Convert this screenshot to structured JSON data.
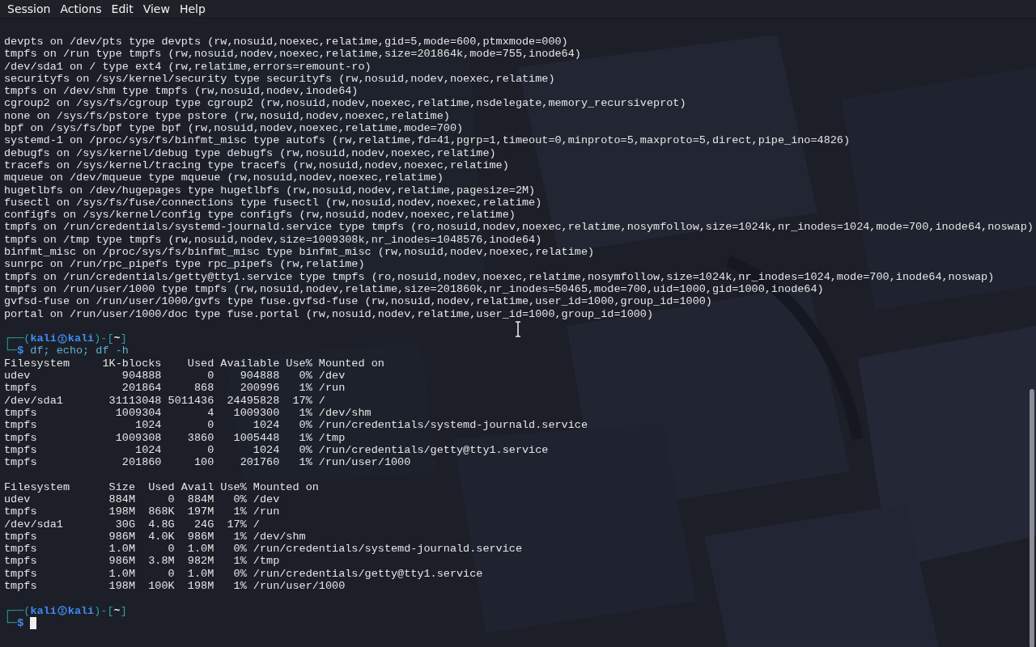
{
  "menu": [
    {
      "label": "Session"
    },
    {
      "label": "Actions"
    },
    {
      "label": "Edit"
    },
    {
      "label": "View"
    },
    {
      "label": "Help"
    }
  ],
  "blocks": [
    {
      "kind": "output",
      "lines": [
        "devpts on /dev/pts type devpts (rw,nosuid,noexec,relatime,gid=5,mode=600,ptmxmode=000)",
        "tmpfs on /run type tmpfs (rw,nosuid,nodev,noexec,relatime,size=201864k,mode=755,inode64)",
        "/dev/sda1 on / type ext4 (rw,relatime,errors=remount-ro)",
        "securityfs on /sys/kernel/security type securityfs (rw,nosuid,nodev,noexec,relatime)",
        "tmpfs on /dev/shm type tmpfs (rw,nosuid,nodev,inode64)",
        "cgroup2 on /sys/fs/cgroup type cgroup2 (rw,nosuid,nodev,noexec,relatime,nsdelegate,memory_recursiveprot)",
        "none on /sys/fs/pstore type pstore (rw,nosuid,nodev,noexec,relatime)",
        "bpf on /sys/fs/bpf type bpf (rw,nosuid,nodev,noexec,relatime,mode=700)",
        "systemd-1 on /proc/sys/fs/binfmt_misc type autofs (rw,relatime,fd=41,pgrp=1,timeout=0,minproto=5,maxproto=5,direct,pipe_ino=4826)",
        "debugfs on /sys/kernel/debug type debugfs (rw,nosuid,nodev,noexec,relatime)",
        "tracefs on /sys/kernel/tracing type tracefs (rw,nosuid,nodev,noexec,relatime)",
        "mqueue on /dev/mqueue type mqueue (rw,nosuid,nodev,noexec,relatime)",
        "hugetlbfs on /dev/hugepages type hugetlbfs (rw,nosuid,nodev,relatime,pagesize=2M)",
        "fusectl on /sys/fs/fuse/connections type fusectl (rw,nosuid,nodev,noexec,relatime)",
        "configfs on /sys/kernel/config type configfs (rw,nosuid,nodev,noexec,relatime)",
        "tmpfs on /run/credentials/systemd-journald.service type tmpfs (ro,nosuid,nodev,noexec,relatime,nosymfollow,size=1024k,nr_inodes=1024,mode=700,inode64,noswap)",
        "tmpfs on /tmp type tmpfs (rw,nosuid,nodev,size=1009308k,nr_inodes=1048576,inode64)",
        "binfmt_misc on /proc/sys/fs/binfmt_misc type binfmt_misc (rw,nosuid,nodev,noexec,relatime)",
        "sunrpc on /run/rpc_pipefs type rpc_pipefs (rw,relatime)",
        "tmpfs on /run/credentials/getty@tty1.service type tmpfs (ro,nosuid,nodev,noexec,relatime,nosymfollow,size=1024k,nr_inodes=1024,mode=700,inode64,noswap)",
        "tmpfs on /run/user/1000 type tmpfs (rw,nosuid,nodev,relatime,size=201860k,nr_inodes=50465,mode=700,uid=1000,gid=1000,inode64)",
        "gvfsd-fuse on /run/user/1000/gvfs type fuse.gvfsd-fuse (rw,nosuid,nodev,relatime,user_id=1000,group_id=1000)",
        "portal on /run/user/1000/doc type fuse.portal (rw,nosuid,nodev,relatime,user_id=1000,group_id=1000)"
      ]
    },
    {
      "kind": "prompt",
      "frame_open": "┌──(",
      "user": "kali",
      "host": "kali",
      "frame_mid": ")-[",
      "dir": "~",
      "frame_close": "]",
      "frame_bottom": "└─",
      "symbol": "$",
      "command": "df; echo; df -h",
      "cursor": false
    },
    {
      "kind": "output",
      "lines": [
        "Filesystem     1K-blocks    Used Available Use% Mounted on",
        "udev              904888       0    904888   0% /dev",
        "tmpfs             201864     868    200996   1% /run",
        "/dev/sda1       31113048 5011436  24495828  17% /",
        "tmpfs            1009304       4   1009300   1% /dev/shm",
        "tmpfs               1024       0      1024   0% /run/credentials/systemd-journald.service",
        "tmpfs            1009308    3860   1005448   1% /tmp",
        "tmpfs               1024       0      1024   0% /run/credentials/getty@tty1.service",
        "tmpfs             201860     100    201760   1% /run/user/1000"
      ]
    },
    {
      "kind": "blank"
    },
    {
      "kind": "output",
      "lines": [
        "Filesystem      Size  Used Avail Use% Mounted on",
        "udev            884M     0  884M   0% /dev",
        "tmpfs           198M  868K  197M   1% /run",
        "/dev/sda1        30G  4.8G   24G  17% /",
        "tmpfs           986M  4.0K  986M   1% /dev/shm",
        "tmpfs           1.0M     0  1.0M   0% /run/credentials/systemd-journald.service",
        "tmpfs           986M  3.8M  982M   1% /tmp",
        "tmpfs           1.0M     0  1.0M   0% /run/credentials/getty@tty1.service",
        "tmpfs           198M  100K  198M   1% /run/user/1000"
      ]
    },
    {
      "kind": "prompt",
      "frame_open": "┌──(",
      "user": "kali",
      "host": "kali",
      "frame_mid": ")-[",
      "dir": "~",
      "frame_close": "]",
      "frame_bottom": "└─",
      "symbol": "$",
      "cursor": true
    }
  ]
}
